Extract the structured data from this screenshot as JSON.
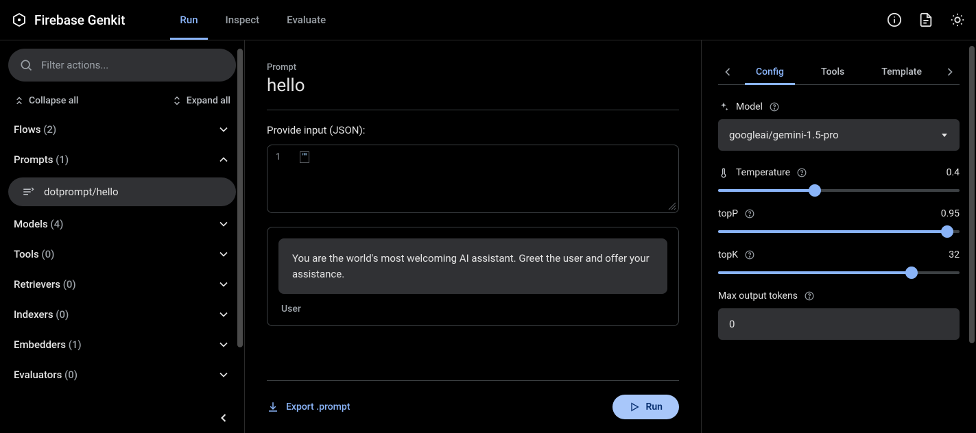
{
  "header": {
    "title": "Firebase Genkit",
    "tabs": {
      "run": "Run",
      "inspect": "Inspect",
      "evaluate": "Evaluate"
    }
  },
  "sidebar": {
    "search_placeholder": "Filter actions...",
    "collapse_all": "Collapse all",
    "expand_all": "Expand all",
    "categories": {
      "flows": {
        "label": "Flows",
        "count": "(2)"
      },
      "prompts": {
        "label": "Prompts",
        "count": "(1)",
        "items": [
          "dotprompt/hello"
        ]
      },
      "models": {
        "label": "Models",
        "count": "(4)"
      },
      "tools": {
        "label": "Tools",
        "count": "(0)"
      },
      "retrievers": {
        "label": "Retrievers",
        "count": "(0)"
      },
      "indexers": {
        "label": "Indexers",
        "count": "(0)"
      },
      "embedders": {
        "label": "Embedders",
        "count": "(1)"
      },
      "evaluators": {
        "label": "Evaluators",
        "count": "(0)"
      }
    }
  },
  "main": {
    "crumb": "Prompt",
    "title": "hello",
    "input_label": "Provide input (JSON):",
    "json_lineno": "1",
    "json_content": "\"\"",
    "system_message": "You are the world's most welcoming AI assistant. Greet the user and offer your assistance.",
    "role_label": "User",
    "export_label": "Export .prompt",
    "run_label": "Run"
  },
  "config": {
    "tabs": {
      "config": "Config",
      "tools": "Tools",
      "template": "Template"
    },
    "model": {
      "label": "Model",
      "value": "googleai/gemini-1.5-pro"
    },
    "temperature": {
      "label": "Temperature",
      "value": "0.4",
      "percent": 40
    },
    "topP": {
      "label": "topP",
      "value": "0.95",
      "percent": 95
    },
    "topK": {
      "label": "topK",
      "value": "32",
      "percent": 80
    },
    "maxTokens": {
      "label": "Max output tokens",
      "value": "0"
    }
  }
}
